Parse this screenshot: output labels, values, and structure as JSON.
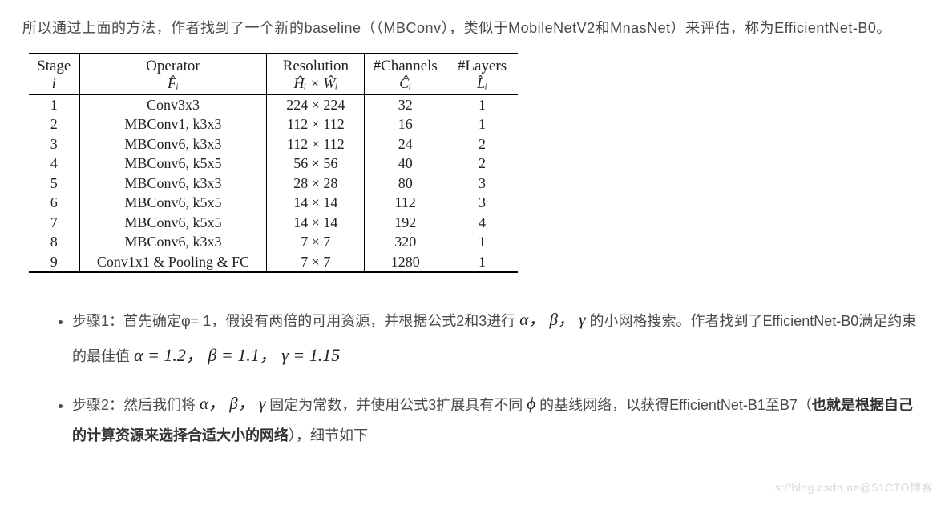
{
  "intro": "所以通过上面的方法，作者找到了一个新的baseline（（MBConv），类似于MobileNetV2和MnasNet）来评估，称为EfficientNet-B0。",
  "table": {
    "headers": {
      "stage": "Stage",
      "stage_sub": "i",
      "operator": "Operator",
      "operator_sub": "F̂ᵢ",
      "resolution": "Resolution",
      "resolution_sub": "Ĥᵢ × Ŵᵢ",
      "channels": "#Channels",
      "channels_sub": "Ĉᵢ",
      "layers": "#Layers",
      "layers_sub": "L̂ᵢ"
    },
    "rows": [
      {
        "stage": "1",
        "operator": "Conv3x3",
        "resolution": "224 × 224",
        "channels": "32",
        "layers": "1"
      },
      {
        "stage": "2",
        "operator": "MBConv1, k3x3",
        "resolution": "112 × 112",
        "channels": "16",
        "layers": "1"
      },
      {
        "stage": "3",
        "operator": "MBConv6, k3x3",
        "resolution": "112 × 112",
        "channels": "24",
        "layers": "2"
      },
      {
        "stage": "4",
        "operator": "MBConv6, k5x5",
        "resolution": "56 × 56",
        "channels": "40",
        "layers": "2"
      },
      {
        "stage": "5",
        "operator": "MBConv6, k3x3",
        "resolution": "28 × 28",
        "channels": "80",
        "layers": "3"
      },
      {
        "stage": "6",
        "operator": "MBConv6, k5x5",
        "resolution": "14 × 14",
        "channels": "112",
        "layers": "3"
      },
      {
        "stage": "7",
        "operator": "MBConv6, k5x5",
        "resolution": "14 × 14",
        "channels": "192",
        "layers": "4"
      },
      {
        "stage": "8",
        "operator": "MBConv6, k3x3",
        "resolution": "7 × 7",
        "channels": "320",
        "layers": "1"
      },
      {
        "stage": "9",
        "operator": "Conv1x1 & Pooling & FC",
        "resolution": "7 × 7",
        "channels": "1280",
        "layers": "1"
      }
    ]
  },
  "step1": {
    "prefix": "步骤1：首先确定φ= 1，假设有两倍的可用资源，并根据公式2和3进行 ",
    "greek1": "α， β， γ",
    "mid": " 的小网格搜索。作者找到了EfficientNet-B0满足约束的最佳值 ",
    "formula": "α = 1.2， β = 1.1， γ = 1.15"
  },
  "step2": {
    "prefix": "步骤2：然后我们将 ",
    "greek1": "α， β， γ",
    "mid": " 固定为常数，并使用公式3扩展具有不同 ",
    "phi": "ϕ",
    "after_phi": " 的基线网络，以获得EfficientNet-B1至B7（",
    "bold": "也就是根据自己的计算资源来选择合适大小的网络",
    "suffix": "），细节如下"
  },
  "watermark": "s://blog.csdn.ne@51CTO博客"
}
